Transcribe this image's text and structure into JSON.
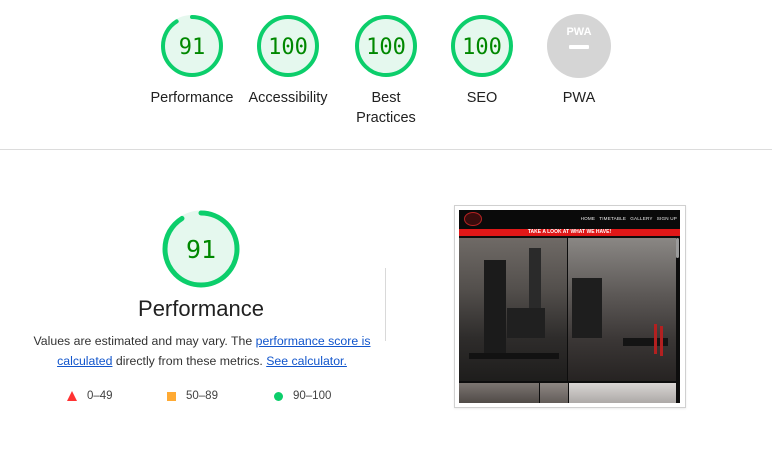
{
  "categories": [
    {
      "id": "performance",
      "score": "91",
      "label": "Performance",
      "status": "pass"
    },
    {
      "id": "accessibility",
      "score": "100",
      "label": "Accessibility",
      "status": "pass"
    },
    {
      "id": "best-practices",
      "score": "100",
      "label": "Best Practices",
      "status": "pass"
    },
    {
      "id": "seo",
      "score": "100",
      "label": "SEO",
      "status": "pass"
    },
    {
      "id": "pwa",
      "score": "",
      "label": "PWA",
      "status": "na",
      "badge": "PWA"
    }
  ],
  "performance": {
    "score": "91",
    "score_fraction": 0.91,
    "title": "Performance",
    "desc_prefix": "Values are estimated and may vary. The ",
    "desc_link1": "performance score is calculated",
    "desc_middle": " directly from these metrics. ",
    "desc_link2": "See calculator."
  },
  "legend": [
    {
      "shape": "triangle",
      "range": "0–49",
      "color": "#ff3333"
    },
    {
      "shape": "square",
      "range": "50–89",
      "color": "#ffaa33"
    },
    {
      "shape": "circle",
      "range": "90–100",
      "color": "#0cce6b"
    }
  ],
  "thumbnail": {
    "nav_items": [
      "HOME",
      "TIMETABLE",
      "GALLERY",
      "SIGN UP"
    ],
    "banner": "TAKE A LOOK AT WHAT WE HAVE!"
  },
  "colors": {
    "pass": "#0cce6b",
    "pass_fill": "#e5f8ee",
    "pass_text": "#008800",
    "na": "#d5d5d5"
  }
}
